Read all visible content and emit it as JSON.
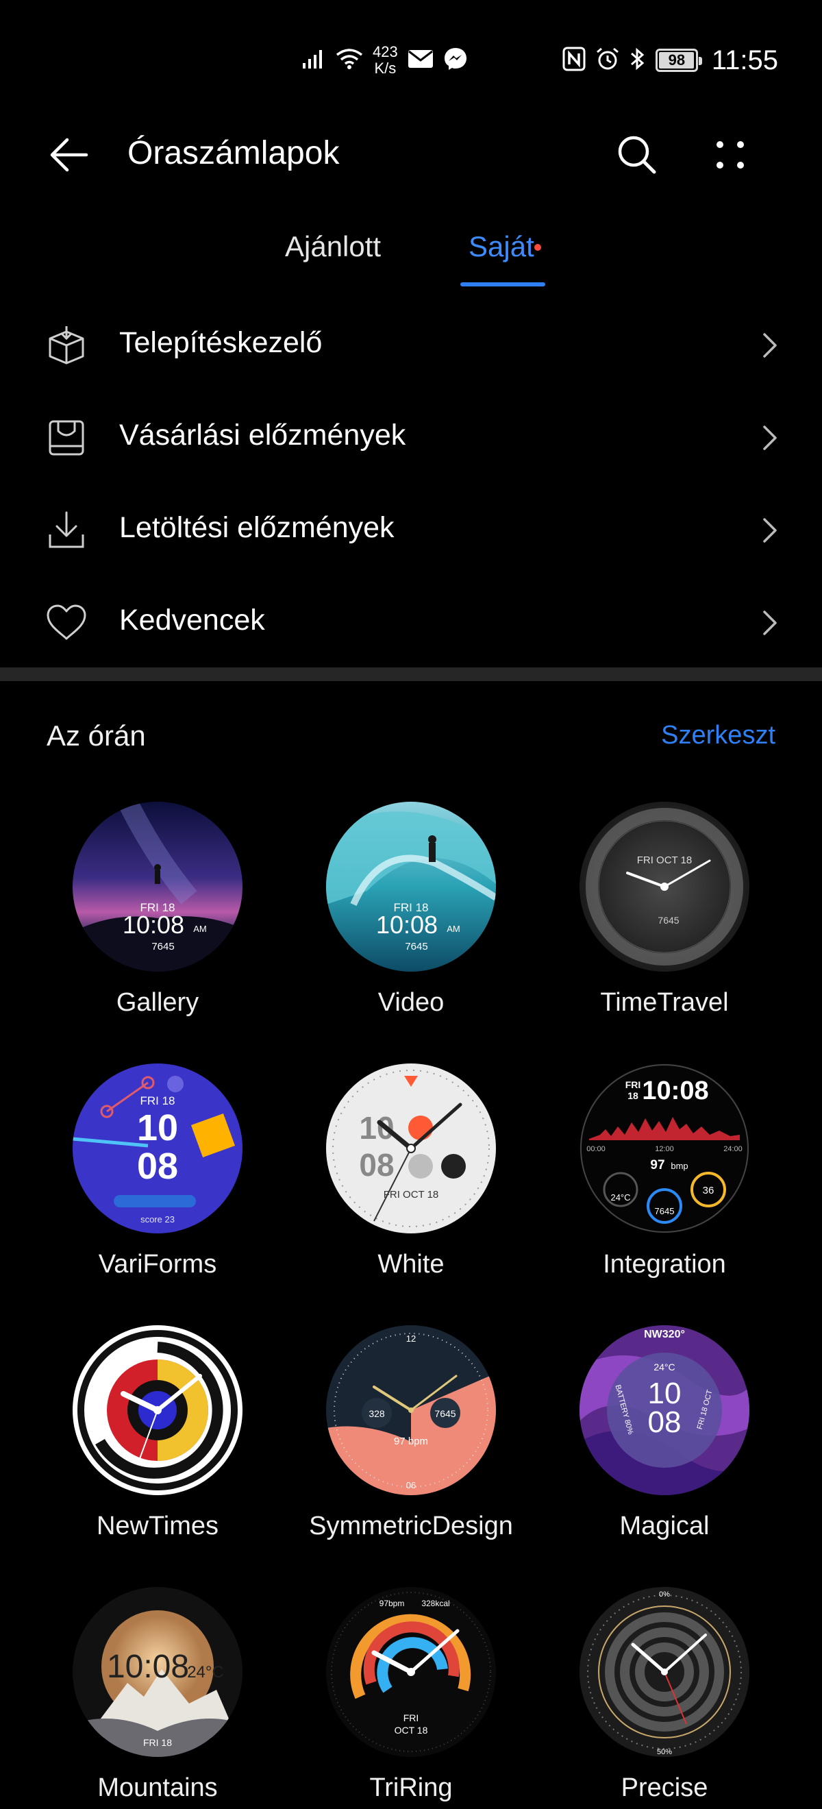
{
  "status_bar": {
    "net_speed_value": "423",
    "net_speed_unit": "K/s",
    "battery": "98",
    "battery_level": 0.98,
    "time": "11:55"
  },
  "header": {
    "title": "Óraszámlapok"
  },
  "tabs": [
    {
      "label": "Ajánlott",
      "active": false
    },
    {
      "label": "Saját",
      "active": true,
      "has_notification_dot": true
    }
  ],
  "menu": [
    {
      "label": "Telepítéskezelő",
      "icon": "install-manager-icon"
    },
    {
      "label": "Vásárlási előzmények",
      "icon": "purchase-history-icon"
    },
    {
      "label": "Letöltési előzmények",
      "icon": "download-history-icon"
    },
    {
      "label": "Kedvencek",
      "icon": "heart-icon"
    }
  ],
  "on_watch": {
    "title": "Az órán",
    "edit_label": "Szerkeszt"
  },
  "faces": [
    {
      "name": "Gallery"
    },
    {
      "name": "Video"
    },
    {
      "name": "TimeTravel"
    },
    {
      "name": "VariForms"
    },
    {
      "name": "White"
    },
    {
      "name": "Integration"
    },
    {
      "name": "NewTimes"
    },
    {
      "name": "SymmetricDesign"
    },
    {
      "name": "Magical"
    },
    {
      "name": "Mountains"
    },
    {
      "name": "TriRing"
    },
    {
      "name": "Precise"
    }
  ],
  "face_text": {
    "gallery": {
      "day": "FRI 18",
      "time": "10:08",
      "ampm": "AM",
      "steps": "7645"
    },
    "video": {
      "day": "FRI 18",
      "time": "10:08",
      "ampm": "AM",
      "steps": "7645"
    },
    "timetravel": {
      "date": "FRI OCT 18",
      "steps": "7645"
    },
    "variforms": {
      "day": "FRI 18",
      "hour": "10",
      "min": "08",
      "score": "score 23"
    },
    "white": {
      "hour": "10",
      "min": "08",
      "date": "FRI OCT 18"
    },
    "integration": {
      "day": "FRI",
      "date": "18",
      "time": "10:08",
      "bpm": "97",
      "bpm_unit": "bmp",
      "t0": "00:00",
      "t1": "12:00",
      "t2": "24:00",
      "temp": "24°C",
      "steps": "7645",
      "num": "36"
    },
    "symmetric": {
      "top": "12",
      "bottom": "06",
      "left_val": "328",
      "right_val": "7645",
      "bpm": "97 bpm"
    },
    "magical": {
      "top": "NW320°",
      "temp": "24°C",
      "hour": "10",
      "min": "08",
      "battery": "BATTERY 80%",
      "date": "FRI 18 OCT"
    },
    "mountains": {
      "time": "10:08",
      "temp": "24°C",
      "date": "FRI 18"
    },
    "triring": {
      "date1": "FRI",
      "date2": "OCT 18",
      "kcal": "328kcal",
      "bpm": "97bpm"
    },
    "precise": {
      "top": "0%",
      "bottom": "50%"
    }
  }
}
